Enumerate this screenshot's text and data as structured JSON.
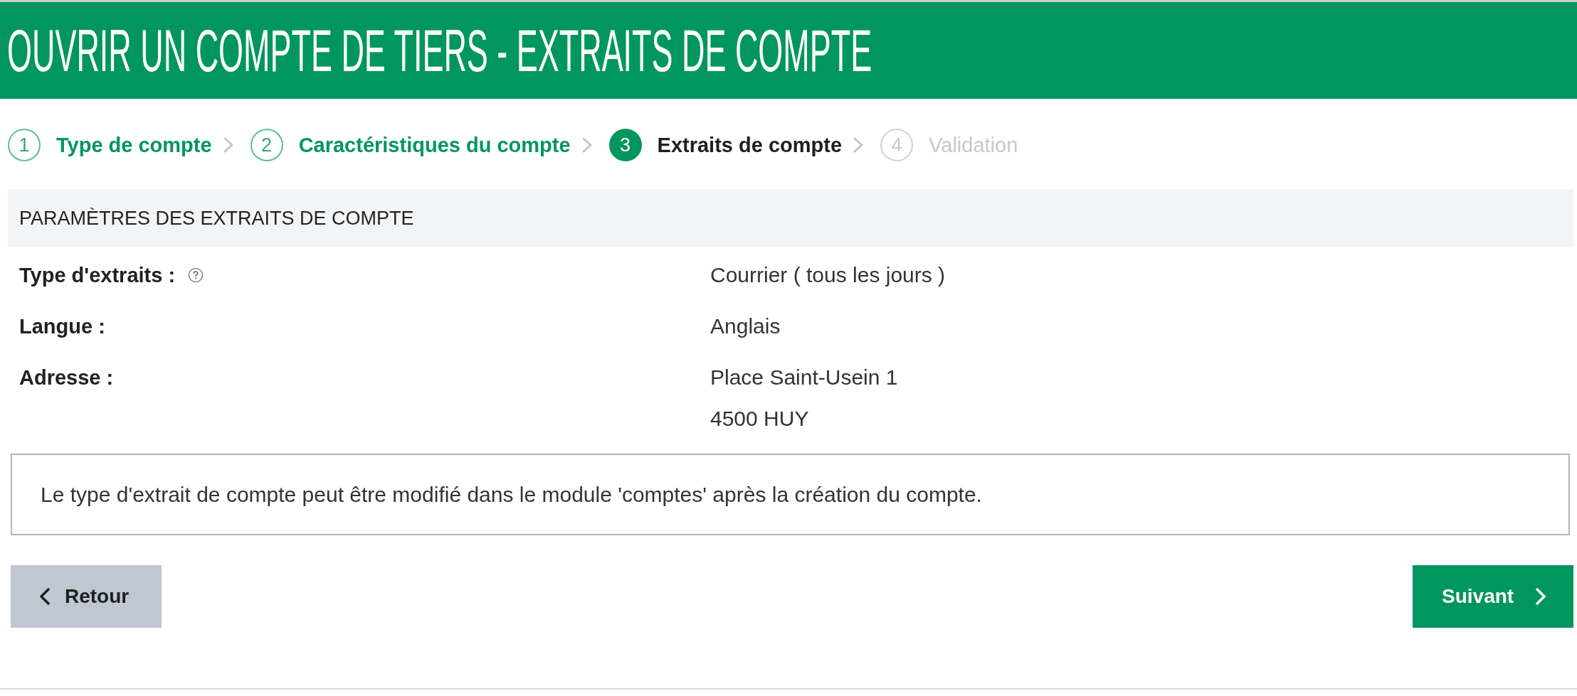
{
  "header": {
    "title": "OUVRIR UN COMPTE DE TIERS - EXTRAITS DE COMPTE"
  },
  "steps": [
    {
      "number": "1",
      "label": "Type de compte",
      "completed": true,
      "selected": false
    },
    {
      "number": "2",
      "label": "Caractéristiques du compte",
      "completed": true,
      "selected": false
    },
    {
      "number": "3",
      "label": "Extraits de compte",
      "completed": false,
      "selected": true
    },
    {
      "number": "4",
      "label": "Validation",
      "completed": false,
      "selected": false
    }
  ],
  "section": {
    "title": "PARAMÈTRES DES EXTRAITS DE COMPTE",
    "rows": [
      {
        "label": "Type d'extraits :",
        "help": true,
        "values": [
          "Courrier ( tous les jours )"
        ]
      },
      {
        "label": "Langue :",
        "help": false,
        "values": [
          "Anglais"
        ]
      },
      {
        "label": "Adresse :",
        "help": false,
        "values": [
          "Place Saint-Usein 1",
          "4500 HUY"
        ]
      }
    ]
  },
  "note": "Le type d'extrait de compte peut être modifié dans le module 'comptes' après la création du compte.",
  "buttons": [
    {
      "label": "Retour",
      "kind": "back"
    },
    {
      "label": "Suivant",
      "kind": "next"
    }
  ]
}
